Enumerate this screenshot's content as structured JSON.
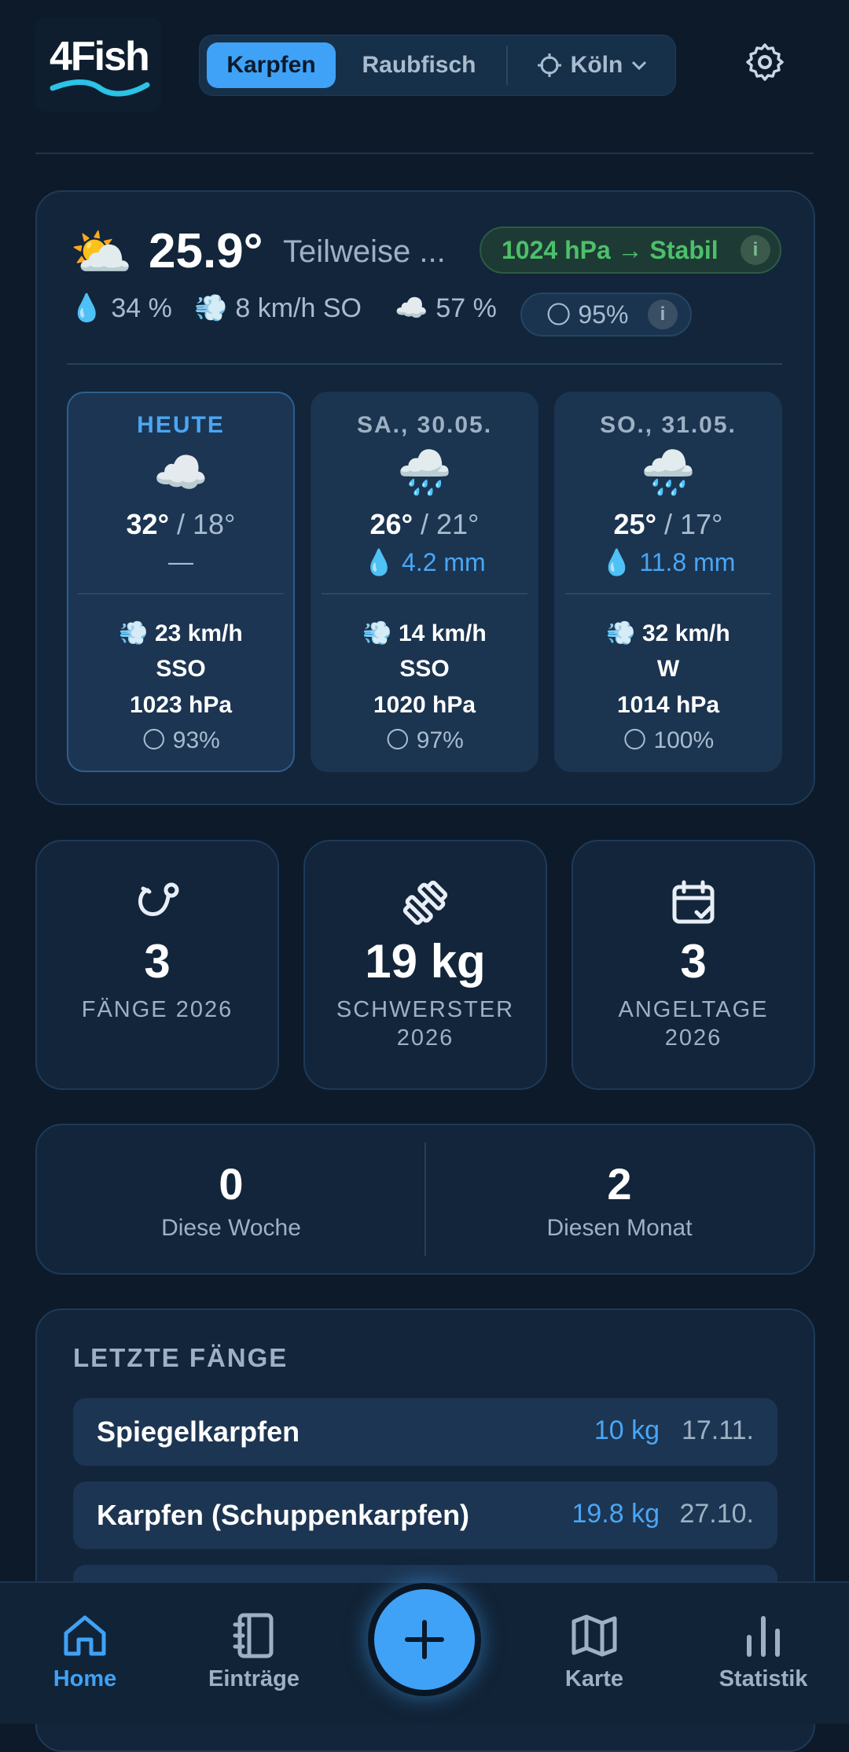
{
  "app": {
    "logo_text": "4Fish"
  },
  "header": {
    "segments": [
      "Karpfen",
      "Raubfisch"
    ],
    "location": "Köln",
    "colors": {
      "accent": "#3fa2f6",
      "background": "#0d1a2a"
    }
  },
  "weather": {
    "current_icon": "⛅",
    "temperature": "25.9°",
    "description": "Teilweise ...",
    "pressure_badge": "1024 hPa → Stabil",
    "humidity": "34 %",
    "wind": "8 km/h SO",
    "cloud_cover": "57 %",
    "moon": "95%",
    "info_label": "i",
    "forecast": [
      {
        "day": "HEUTE",
        "icon": "☁️",
        "high": "32°",
        "low": "18°",
        "rain": "—",
        "wind": "23 km/h",
        "dir": "SSO",
        "pressure": "1023 hPa",
        "moon": "93%"
      },
      {
        "day": "SA., 30.05.",
        "icon": "🌧️",
        "high": "26°",
        "low": "21°",
        "rain": "4.2 mm",
        "wind": "14 km/h",
        "dir": "SSO",
        "pressure": "1020 hPa",
        "moon": "97%"
      },
      {
        "day": "SO., 31.05.",
        "icon": "🌧️",
        "high": "25°",
        "low": "17°",
        "rain": "11.8 mm",
        "wind": "32 km/h",
        "dir": "W",
        "pressure": "1014 hPa",
        "moon": "100%"
      }
    ]
  },
  "stats": [
    {
      "value": "3",
      "label": "FÄNGE 2026",
      "icon": "hook-icon"
    },
    {
      "value": "19 kg",
      "label": "SCHWERSTER 2026",
      "icon": "weight-icon"
    },
    {
      "value": "3",
      "label": "ANGELTAGE 2026",
      "icon": "calendar-check-icon"
    }
  ],
  "period": [
    {
      "value": "0",
      "label": "Diese Woche"
    },
    {
      "value": "2",
      "label": "Diesen Monat"
    }
  ],
  "recent": {
    "title": "LETZTE FÄNGE",
    "items": [
      {
        "name": "Spiegelkarpfen",
        "weight": "10 kg",
        "date": "17.11."
      },
      {
        "name": "Karpfen (Schuppenkarpfen)",
        "weight": "19.8 kg",
        "date": "27.10."
      }
    ]
  },
  "nav": {
    "items": [
      "Home",
      "Einträge",
      "Karte",
      "Statistik"
    ],
    "fab_label": "+"
  }
}
